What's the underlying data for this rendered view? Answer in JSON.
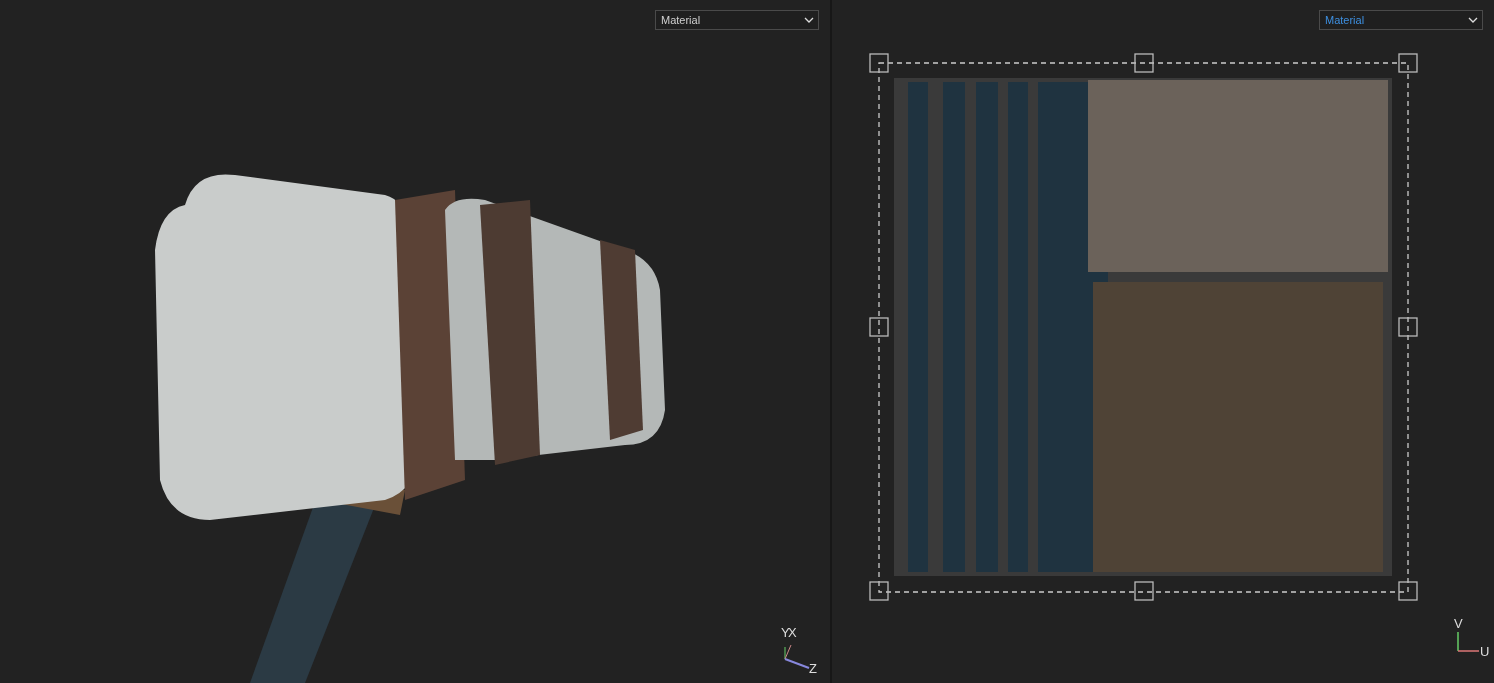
{
  "viewports": [
    {
      "kind": "model",
      "dropdown": {
        "value": "Material",
        "focused": false
      },
      "axes": [
        "Y",
        "X",
        "Z"
      ]
    },
    {
      "kind": "uv",
      "dropdown": {
        "value": "Material",
        "focused": true
      },
      "axes": [
        "V",
        "U"
      ]
    }
  ]
}
